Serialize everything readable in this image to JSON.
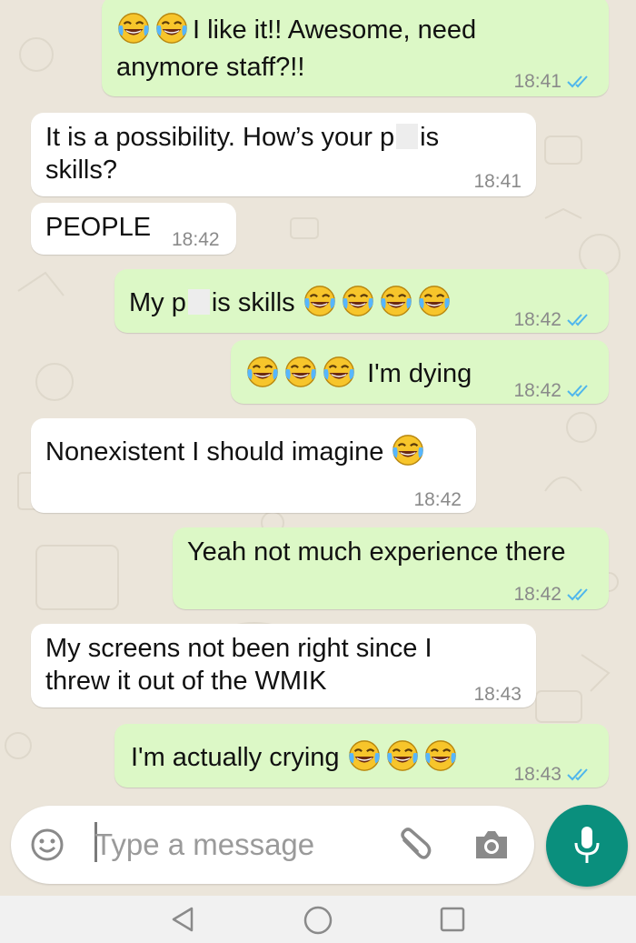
{
  "messages": [
    {
      "dir": "out",
      "text1": "I like it!! Awesome, need",
      "text2": "anymore staff?!!",
      "time": "18:41"
    },
    {
      "dir": "in",
      "text1a": "It is a possibility. How’s your p",
      "text1b": "is",
      "text2": "skills?",
      "time": "18:41"
    },
    {
      "dir": "in",
      "text": "PEOPLE",
      "time": "18:42"
    },
    {
      "dir": "out",
      "text_a": "My p",
      "text_b": "is skills",
      "time": "18:42"
    },
    {
      "dir": "out",
      "text": "I'm dying",
      "time": "18:42"
    },
    {
      "dir": "in",
      "text": "Nonexistent I should imagine",
      "time": "18:42"
    },
    {
      "dir": "out",
      "text": "Yeah not much experience there",
      "time": "18:42"
    },
    {
      "dir": "in",
      "text1": "My screens not been right since I",
      "text2": "threw it out of the WMIK",
      "time": "18:43"
    },
    {
      "dir": "out",
      "text": "I'm actually crying",
      "time": "18:43"
    }
  ],
  "input": {
    "placeholder": "Type a message"
  },
  "icons": {
    "emoji_button": "smiley-icon",
    "attach": "paperclip-icon",
    "camera": "camera-icon",
    "mic": "microphone-icon",
    "read_receipt": "double-check-icon",
    "reaction_emoji": "face-with-tears-of-joy-emoji",
    "nav_back": "back-triangle-icon",
    "nav_home": "home-circle-icon",
    "nav_recents": "recents-square-icon"
  },
  "colors": {
    "outgoing": "#dcf8c6",
    "incoming": "#ffffff",
    "tick": "#4fb6ec",
    "mic": "#0a8f7d"
  }
}
